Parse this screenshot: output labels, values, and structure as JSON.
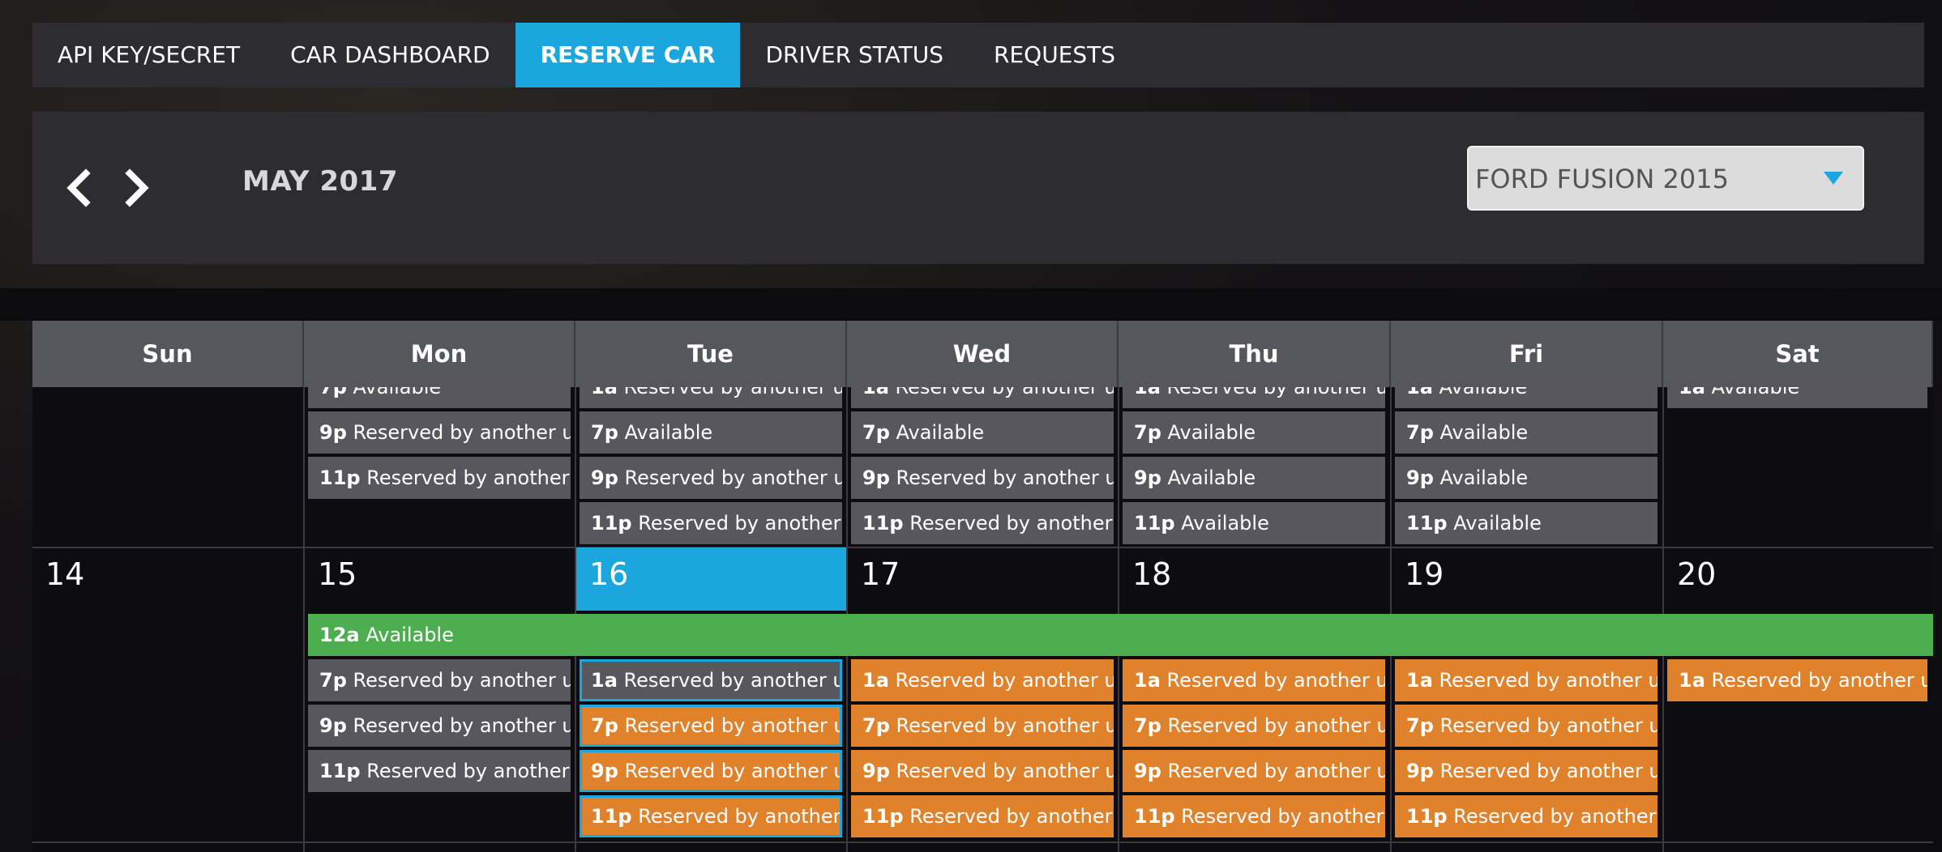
{
  "nav": {
    "tabs": [
      {
        "label": "API KEY/SECRET"
      },
      {
        "label": "CAR DASHBOARD"
      },
      {
        "label": "RESERVE CAR",
        "active": true
      },
      {
        "label": "DRIVER STATUS"
      },
      {
        "label": "REQUESTS"
      }
    ]
  },
  "toolbar": {
    "prev_icon": "chevron-left-icon",
    "next_icon": "chevron-right-icon",
    "month_label": "MAY 2017",
    "car_select": {
      "value": "FORD FUSION 2015"
    }
  },
  "calendar": {
    "weekdays": [
      "Sun",
      "Mon",
      "Tue",
      "Wed",
      "Thu",
      "Fri",
      "Sat"
    ],
    "week1_events": [
      {
        "day": "Mon",
        "time": "7p",
        "text": "Available",
        "color": "gray"
      },
      {
        "day": "Mon",
        "time": "9p",
        "text": "Reserved by another user",
        "color": "gray"
      },
      {
        "day": "Mon",
        "time": "11p",
        "text": "Reserved by another use",
        "color": "gray"
      },
      {
        "day": "Tue",
        "time": "1a",
        "text": "Reserved by another user",
        "color": "gray"
      },
      {
        "day": "Tue",
        "time": "7p",
        "text": "Available",
        "color": "gray"
      },
      {
        "day": "Tue",
        "time": "9p",
        "text": "Reserved by another user",
        "color": "gray"
      },
      {
        "day": "Tue",
        "time": "11p",
        "text": "Reserved by another use",
        "color": "gray"
      },
      {
        "day": "Wed",
        "time": "1a",
        "text": "Reserved by another user",
        "color": "gray"
      },
      {
        "day": "Wed",
        "time": "7p",
        "text": "Available",
        "color": "gray"
      },
      {
        "day": "Wed",
        "time": "9p",
        "text": "Reserved by another user",
        "color": "gray"
      },
      {
        "day": "Wed",
        "time": "11p",
        "text": "Reserved by another use",
        "color": "gray"
      },
      {
        "day": "Thu",
        "time": "1a",
        "text": "Reserved by another user",
        "color": "gray"
      },
      {
        "day": "Thu",
        "time": "7p",
        "text": "Available",
        "color": "gray"
      },
      {
        "day": "Thu",
        "time": "9p",
        "text": "Available",
        "color": "gray"
      },
      {
        "day": "Thu",
        "time": "11p",
        "text": "Available",
        "color": "gray"
      },
      {
        "day": "Fri",
        "time": "1a",
        "text": "Available",
        "color": "gray"
      },
      {
        "day": "Fri",
        "time": "7p",
        "text": "Available",
        "color": "gray"
      },
      {
        "day": "Fri",
        "time": "9p",
        "text": "Available",
        "color": "gray"
      },
      {
        "day": "Fri",
        "time": "11p",
        "text": "Available",
        "color": "gray"
      },
      {
        "day": "Sat",
        "time": "1a",
        "text": "Available",
        "color": "gray"
      }
    ],
    "week2_days": [
      "14",
      "15",
      "16",
      "17",
      "18",
      "19",
      "20"
    ],
    "today": "16",
    "week2_banner": {
      "time": "12a",
      "text": "Available",
      "color": "green"
    },
    "week2_events": [
      {
        "day": "Mon",
        "time": "7p",
        "text": "Reserved by another user",
        "color": "gray"
      },
      {
        "day": "Mon",
        "time": "9p",
        "text": "Reserved by another user",
        "color": "gray"
      },
      {
        "day": "Mon",
        "time": "11p",
        "text": "Reserved by another use",
        "color": "gray"
      },
      {
        "day": "Tue",
        "time": "1a",
        "text": "Reserved by another user",
        "color": "gray"
      },
      {
        "day": "Tue",
        "time": "7p",
        "text": "Reserved by another user",
        "color": "orange"
      },
      {
        "day": "Tue",
        "time": "9p",
        "text": "Reserved by another user",
        "color": "orange"
      },
      {
        "day": "Tue",
        "time": "11p",
        "text": "Reserved by another use",
        "color": "orange"
      },
      {
        "day": "Wed",
        "time": "1a",
        "text": "Reserved by another user",
        "color": "orange"
      },
      {
        "day": "Wed",
        "time": "7p",
        "text": "Reserved by another user",
        "color": "orange"
      },
      {
        "day": "Wed",
        "time": "9p",
        "text": "Reserved by another user",
        "color": "orange"
      },
      {
        "day": "Wed",
        "time": "11p",
        "text": "Reserved by another use",
        "color": "orange"
      },
      {
        "day": "Thu",
        "time": "1a",
        "text": "Reserved by another user",
        "color": "orange"
      },
      {
        "day": "Thu",
        "time": "7p",
        "text": "Reserved by another user",
        "color": "orange"
      },
      {
        "day": "Thu",
        "time": "9p",
        "text": "Reserved by another user",
        "color": "orange"
      },
      {
        "day": "Thu",
        "time": "11p",
        "text": "Reserved by another use",
        "color": "orange"
      },
      {
        "day": "Fri",
        "time": "1a",
        "text": "Reserved by another user",
        "color": "orange"
      },
      {
        "day": "Fri",
        "time": "7p",
        "text": "Reserved by another user",
        "color": "orange"
      },
      {
        "day": "Fri",
        "time": "9p",
        "text": "Reserved by another user",
        "color": "orange"
      },
      {
        "day": "Fri",
        "time": "11p",
        "text": "Reserved by another use",
        "color": "orange"
      },
      {
        "day": "Sat",
        "time": "1a",
        "text": "Reserved by another user",
        "color": "orange"
      }
    ]
  },
  "colors": {
    "accent": "#1ba6dd",
    "available": "#4cae4f",
    "reserved": "#e0812b",
    "slot": "#58575e"
  }
}
